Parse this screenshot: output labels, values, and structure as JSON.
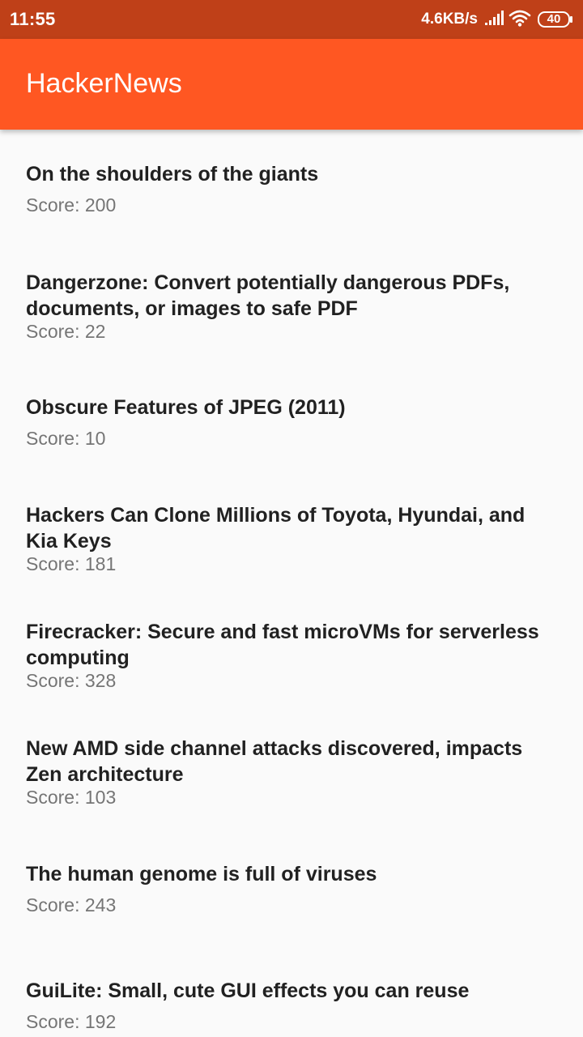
{
  "status_bar": {
    "time": "11:55",
    "net_speed": "4.6KB/s",
    "battery": "40",
    "icons": [
      "signal-icon",
      "wifi-icon",
      "battery-icon"
    ]
  },
  "app_bar": {
    "title": "HackerNews",
    "color": "#ff5722"
  },
  "stories": [
    {
      "title": "On the shoulders of the giants",
      "score": "Score: 200"
    },
    {
      "title": "Dangerzone: Convert potentially dangerous PDFs, documents, or images to safe PDF",
      "score": "Score: 22"
    },
    {
      "title": "Obscure Features of JPEG (2011)",
      "score": "Score: 10"
    },
    {
      "title": "Hackers Can Clone Millions of Toyota, Hyundai, and Kia Keys",
      "score": "Score: 181"
    },
    {
      "title": "Firecracker: Secure and fast microVMs for serverless computing",
      "score": "Score: 328"
    },
    {
      "title": "New AMD side channel attacks discovered, impacts Zen architecture",
      "score": "Score: 103"
    },
    {
      "title": "The human genome is full of viruses",
      "score": "Score: 243"
    },
    {
      "title": "GuiLite: Small, cute GUI effects you can reuse",
      "score": "Score: 192"
    }
  ]
}
